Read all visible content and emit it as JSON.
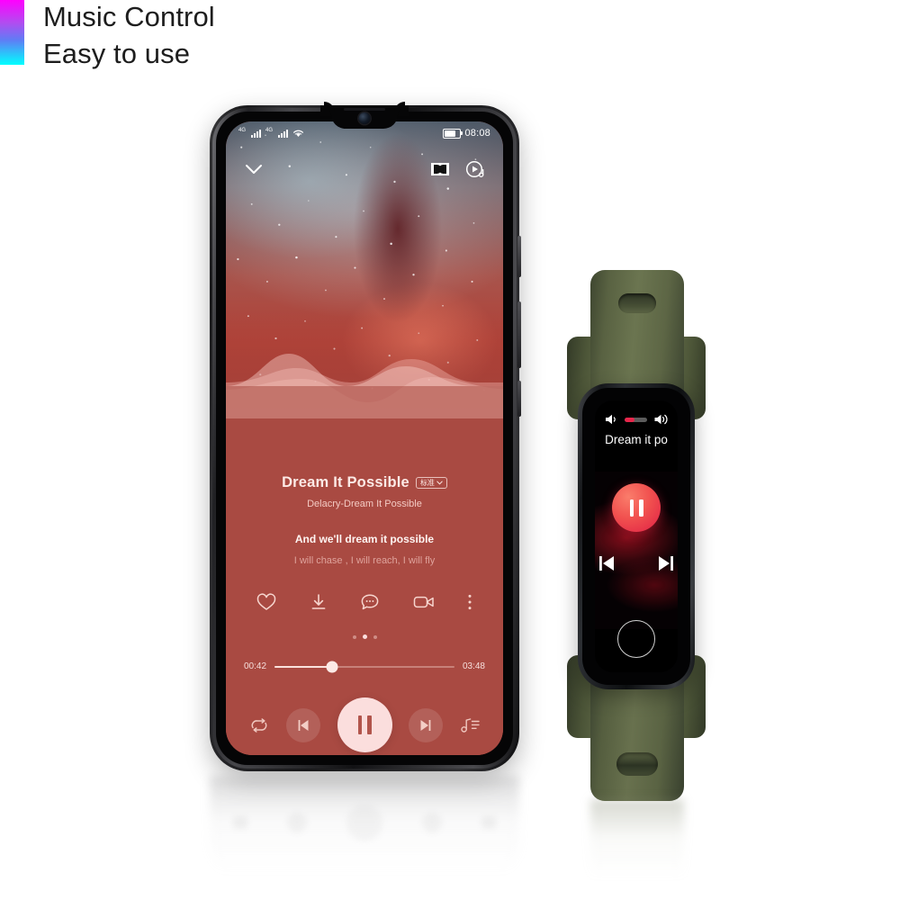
{
  "header": {
    "line1": "Music Control",
    "line2": "Easy to use",
    "accent_start": "#ff00ff",
    "accent_end": "#00ffff"
  },
  "phone": {
    "status_bar": {
      "network_label_1": "4G",
      "network_label_2": "4G",
      "wifi_icon": "wifi-icon",
      "battery_icon": "battery-icon",
      "time": "08:08"
    },
    "top_controls": {
      "collapse_icon": "chevron-down-icon",
      "dolby_icon": "dolby-atmos-icon",
      "video_mv_icon": "music-video-icon"
    },
    "now_playing": {
      "title": "Dream It Possible",
      "quality_badge": "标准",
      "quality_badge_icon": "chevron-down-icon",
      "artist": "Delacry-Dream It Possible",
      "lyric_current": "And we'll dream  it possible",
      "lyric_next": "I will chase ,  I will reach,  I will fly"
    },
    "actions": [
      {
        "name": "favorite-button",
        "icon": "heart-icon"
      },
      {
        "name": "download-button",
        "icon": "download-icon"
      },
      {
        "name": "comment-button",
        "icon": "comment-icon"
      },
      {
        "name": "video-button",
        "icon": "video-camera-icon"
      },
      {
        "name": "more-button",
        "icon": "more-vertical-icon"
      }
    ],
    "page_dots": {
      "count": 3,
      "active_index": 1
    },
    "progress": {
      "elapsed": "00:42",
      "duration": "03:48",
      "percent": 32
    },
    "transport": {
      "repeat_icon": "repeat-icon",
      "previous_icon": "skip-previous-icon",
      "play_pause_icon": "pause-icon",
      "next_icon": "skip-next-icon",
      "playlist_icon": "playlist-queue-icon"
    },
    "theme": {
      "panel": "#a94a42",
      "accent_light": "#fbdedd"
    }
  },
  "band": {
    "strap_color": "#5d6645",
    "volume": {
      "low_icon": "volume-low-icon",
      "high_icon": "volume-high-icon",
      "percent": 45,
      "fill_color": "#e8254a"
    },
    "track_title": "Dream it po",
    "transport": {
      "play_pause_icon": "pause-icon",
      "previous_icon": "skip-previous-icon",
      "next_icon": "skip-next-icon"
    },
    "home_button_icon": "home-circle-icon"
  }
}
